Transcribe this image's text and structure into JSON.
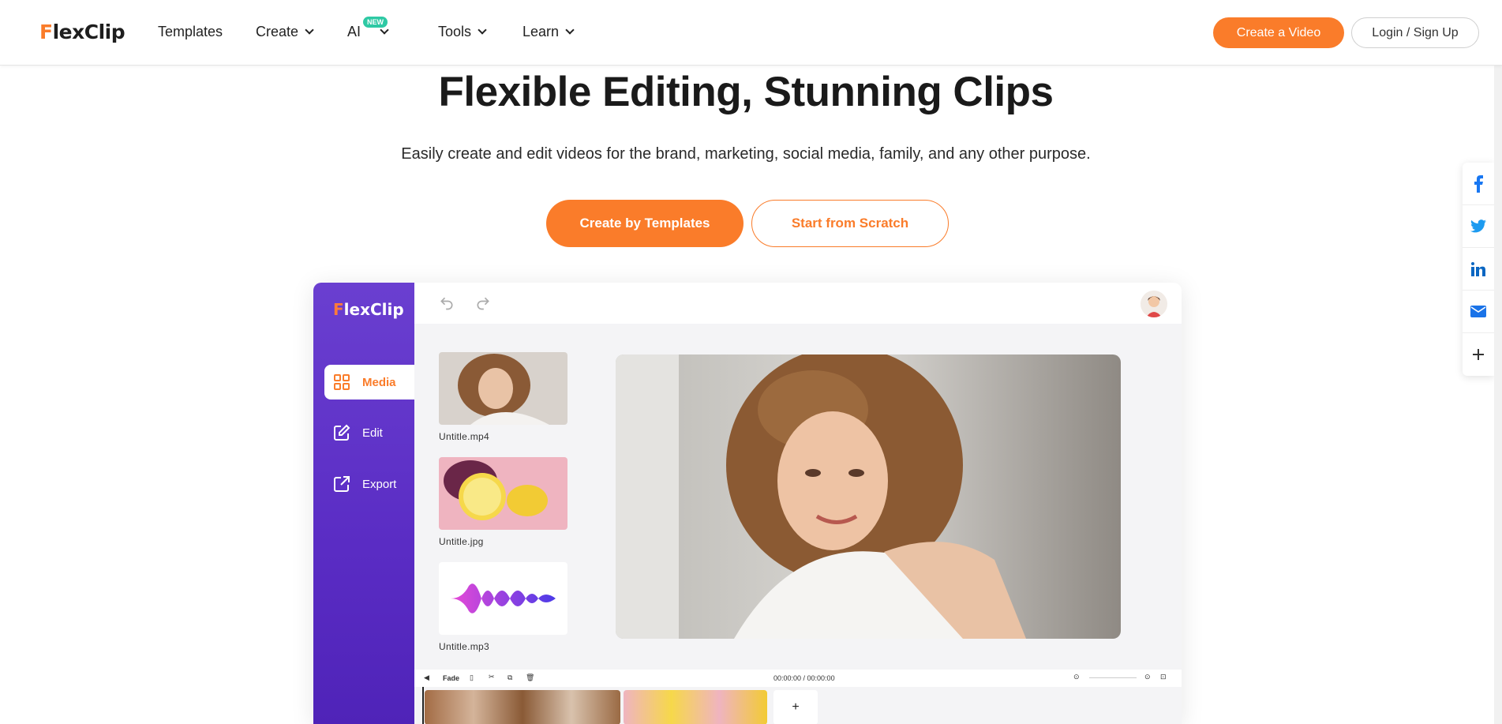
{
  "brand": {
    "logo_f": "F",
    "logo_rest": "lexClip"
  },
  "nav": {
    "templates": "Templates",
    "create": "Create",
    "ai": "AI",
    "ai_badge": "NEW",
    "tools": "Tools",
    "learn": "Learn"
  },
  "header_actions": {
    "create_video": "Create a Video",
    "login": "Login / Sign Up"
  },
  "hero": {
    "title": "Flexible Editing, Stunning Clips",
    "subtitle": "Easily create and edit videos for the brand, marketing, social media, family, and any other purpose.",
    "primary_cta": "Create by Templates",
    "secondary_cta": "Start from Scratch"
  },
  "editor": {
    "logo_f": "F",
    "logo_rest": "lexClip",
    "nav": [
      {
        "label": "Media",
        "icon": "grid-icon"
      },
      {
        "label": "Edit",
        "icon": "edit-icon"
      },
      {
        "label": "Export",
        "icon": "export-icon"
      }
    ],
    "media": [
      {
        "file": "Untitle.mp4",
        "kind": "video"
      },
      {
        "file": "Untitle.jpg",
        "kind": "image"
      },
      {
        "file": "Untitle.mp3",
        "kind": "audio"
      }
    ],
    "timeline": {
      "fade_label": "Fade",
      "timecode": "00:00:00 / 00:00:00",
      "add_label": "+"
    }
  },
  "share": [
    "facebook-icon",
    "twitter-icon",
    "linkedin-icon",
    "mail-icon",
    "plus-icon"
  ],
  "colors": {
    "accent": "#fa7c2a",
    "sidebar_purple": "#5a2cc4",
    "new_badge": "#2ec9a4"
  }
}
